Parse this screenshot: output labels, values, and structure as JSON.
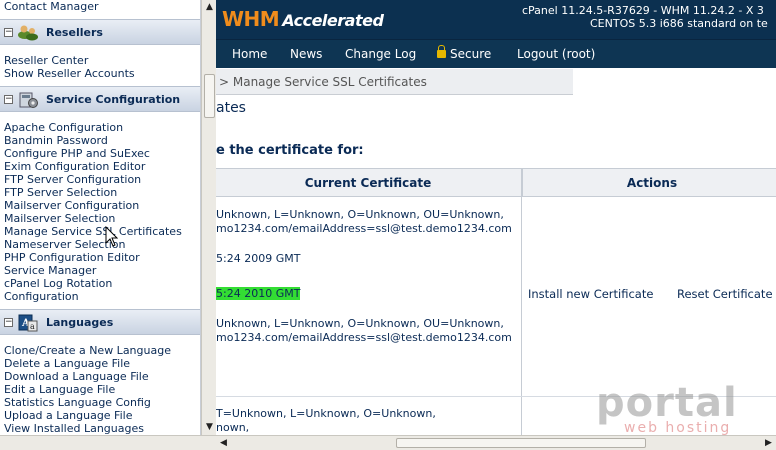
{
  "left_menu": {
    "top_link": "Contact Manager",
    "sections": [
      {
        "title": "Resellers",
        "items": [
          "Reseller Center",
          "Show Reseller Accounts"
        ]
      },
      {
        "title": "Service Configuration",
        "items": [
          "Apache Configuration",
          "Bandmin Password",
          "Configure PHP and SuExec",
          "Exim Configuration Editor",
          "FTP Server Configuration",
          "FTP Server Selection",
          "Mailserver Configuration",
          "Mailserver Selection",
          "Manage Service SSL Certificates",
          "Nameserver Selection",
          "PHP Configuration Editor",
          "Service Manager",
          "cPanel Log Rotation",
          "Configuration"
        ]
      },
      {
        "title": "Languages",
        "items": [
          "Clone/Create a New Language",
          "Delete a Language File",
          "Download a Language File",
          "Edit a Language File",
          "Statistics Language Config",
          "Upload a Language File",
          "View Installed Languages"
        ]
      }
    ]
  },
  "header": {
    "logo_main": "WHM",
    "logo_sub": "Accelerated",
    "version_line1": "cPanel 11.24.5-R37629 - WHM 11.24.2 - X 3",
    "version_line2": "CENTOS 5.3 i686 standard on te"
  },
  "nav": {
    "items": [
      "Home",
      "News",
      "Change Log",
      "Secure",
      "Logout (root)"
    ]
  },
  "breadcrumb": "> Manage Service SSL Certificates",
  "page_title": "ates",
  "prompt": "e the certificate for:",
  "table": {
    "headers": [
      "Current Certificate",
      "Actions"
    ],
    "cert_lines": [
      "Unknown, L=Unknown, O=Unknown, OU=Unknown,",
      "mo1234.com/emailAddress=ssl@test.demo1234.com",
      "5:24 2009 GMT",
      "5:24 2010 GMT",
      "Unknown, L=Unknown, O=Unknown, OU=Unknown,",
      "mo1234.com/emailAddress=ssl@test.demo1234.com",
      "T=Unknown, L=Unknown, O=Unknown,",
      "nown,"
    ],
    "actions": [
      "Install new Certificate",
      "Reset Certificate"
    ]
  },
  "watermark": {
    "main": "portal",
    "sub": "web hosting"
  },
  "colors": {
    "header_bg": "#0c3050",
    "logo_orange": "#f08c1c",
    "highlight_green": "#33dd33",
    "link_text": "#0a2a55"
  }
}
